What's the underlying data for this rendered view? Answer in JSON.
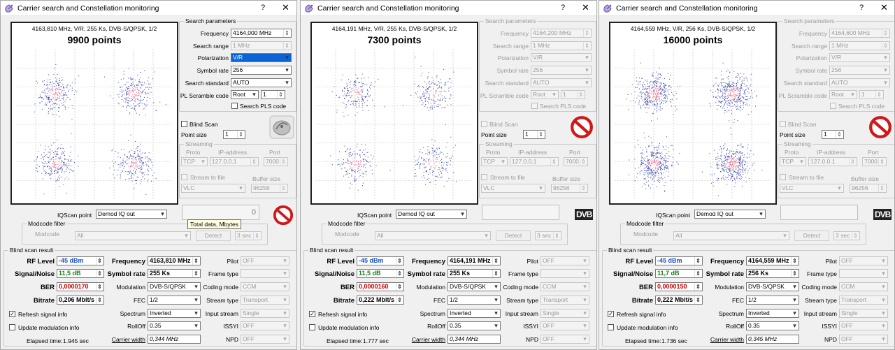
{
  "common": {
    "title": "Carrier search and Constellation monitoring",
    "help": "?",
    "close": "✕",
    "labels": {
      "search_params": "Search parameters",
      "frequency": "Frequency",
      "search_range": "Search range",
      "polarization": "Polarization",
      "symbol_rate": "Symbol rate",
      "search_standard": "Search standard",
      "pl_scramble": "PL Scramble code",
      "search_pls": "Search PLS code",
      "blind_scan": "Blind Scan",
      "point_size": "Point size",
      "streaming": "Streaming",
      "proto": "Proto",
      "ip_address": "IP-address",
      "port": "Port",
      "stream_to_file": "Stream to file",
      "buffer_size": "Buffer size",
      "iqscan_point": "IQScan point",
      "modcode_filter": "Modcode filter",
      "modcode": "Modcode",
      "detect": "Detect",
      "blind_scan_result": "Blind scan result",
      "rf_level": "RF Level",
      "signal_noise": "Signal/Noise",
      "ber": "BER",
      "bitrate": "Bitrate",
      "frequency_r": "Frequency",
      "symbol_rate_r": "Symbol rate",
      "modulation": "Modulation",
      "fec": "FEC",
      "spectrum": "Spectrum",
      "rolloff": "RollOff",
      "carrier_width": "Carrier width",
      "pilot": "Pilot",
      "frame_type": "Frame type",
      "coding_mode": "Coding mode",
      "stream_type": "Stream type",
      "input_stream": "Input stream",
      "issyi": "ISSYI",
      "npd": "NPD",
      "refresh": "Refresh signal info",
      "update_mod": "Update modulation info",
      "elapsed": "Elapsed time:"
    },
    "values": {
      "search_range": "1 MHz",
      "polarization": "V/R",
      "symbol_rate": "256",
      "search_standard": "AUTO",
      "pl_root": "Root",
      "pl_num": "1",
      "point_size": "1",
      "proto": "TCP",
      "ip": "127.0.0.1",
      "port": "7000",
      "buffer": "96256",
      "player": "VLC",
      "iqscan": "Demod IQ out",
      "modcode": "All",
      "detect_time": "3 sec",
      "rf_level": "-45 dBm",
      "modulation": "DVB-S/QPSK",
      "fec": "1/2",
      "spectrum": "Inverted",
      "rolloff": "0.35",
      "pilot": "OFF",
      "frame_type": "",
      "coding_mode": "CCM",
      "stream_type": "Transport",
      "input_stream": "Single",
      "issyi": "OFF",
      "npd": "OFF",
      "dvb_logo": "DVB"
    },
    "colors": {
      "rf": "#1a50c8",
      "snr": "#1a7a1a",
      "ber": "#cc0000",
      "points": "#1f2fa0",
      "center": "#d03060"
    }
  },
  "windows": [
    {
      "header": "4163,810 MHz, V/R, 255 Ks, DVB-S/QPSK, 1/2",
      "points": "9900 points",
      "frequency_in": "4164,000 MHz",
      "snr": "11,5 dB",
      "ber": "0,0000170",
      "bitrate": "0,206 Mbit/s",
      "frequency": "4163,810 MHz",
      "symbol_rate": "255 Ks",
      "carrier_width": "0,344 MHz",
      "elapsed": "1.945 sec",
      "tooltip": "Total data, Mbytes",
      "counter": "0",
      "density": 9900,
      "active": true
    },
    {
      "header": "4164,191 MHz, V/R, 255 Ks, DVB-S/QPSK, 1/2",
      "points": "7300 points",
      "frequency_in": "4164,200 MHz",
      "snr": "11,5 dB",
      "ber": "0,0000160",
      "bitrate": "0,222 Mbit/s",
      "frequency": "4164,191 MHz",
      "symbol_rate": "255 Ks",
      "carrier_width": "0,344 MHz",
      "elapsed": "1.777 sec",
      "tooltip": "",
      "counter": "",
      "density": 7300,
      "active": false
    },
    {
      "header": "4164,559 MHz, V/R, 256 Ks, DVB-S/QPSK, 1/2",
      "points": "16000 points",
      "frequency_in": "4164,600 MHz",
      "snr": "11,7 dB",
      "ber": "0,0000150",
      "bitrate": "0,222 Mbit/s",
      "frequency": "4164,559 MHz",
      "symbol_rate": "256 Ks",
      "carrier_width": "0,345 MHz",
      "elapsed": "1.736 sec",
      "tooltip": "",
      "counter": "",
      "density": 16000,
      "active": false
    }
  ]
}
